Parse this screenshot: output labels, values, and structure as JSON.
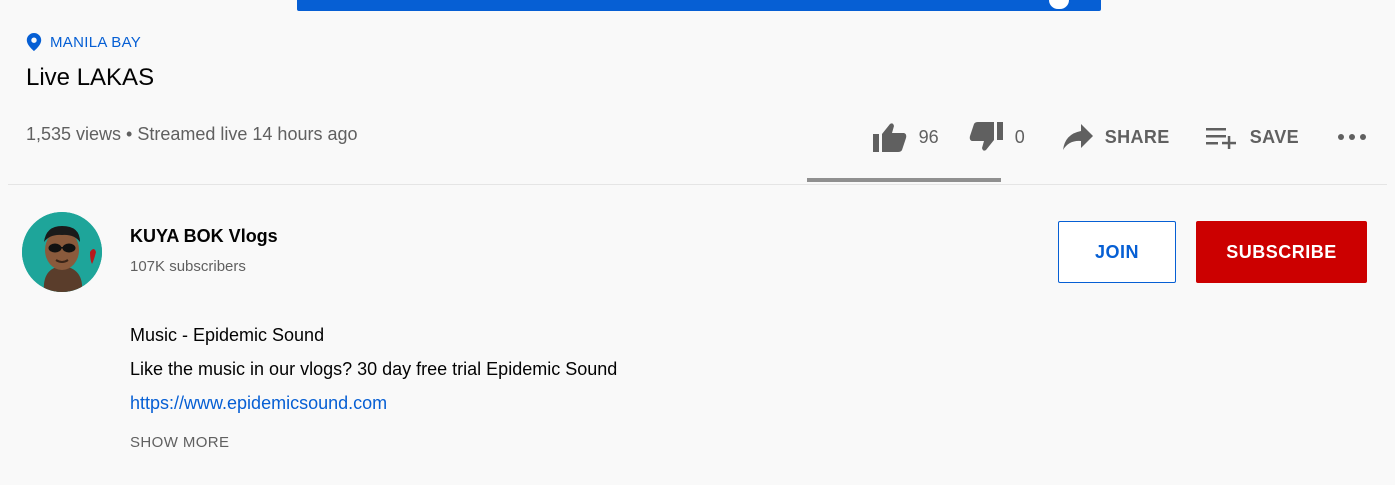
{
  "location": {
    "icon": "location-pin-icon",
    "text": "MANILA BAY"
  },
  "video": {
    "title": "Live LAKAS",
    "meta": "1,535 views • Streamed live 14 hours ago"
  },
  "actions": {
    "like": {
      "icon": "thumbs-up-icon",
      "count": "96"
    },
    "dislike": {
      "icon": "thumbs-down-icon",
      "count": "0"
    },
    "share": {
      "icon": "share-arrow-icon",
      "label": "SHARE"
    },
    "save": {
      "icon": "playlist-add-icon",
      "label": "SAVE"
    },
    "more": {
      "icon": "more-horizontal-icon",
      "label": "..."
    },
    "like_ratio": 1.0
  },
  "channel": {
    "name": "KUYA BOK Vlogs",
    "subscribers": "107K subscribers",
    "join_label": "JOIN",
    "subscribe_label": "SUBSCRIBE"
  },
  "description": {
    "lines": [
      "Music - Epidemic Sound",
      "Like the music in our vlogs? 30 day free trial Epidemic Sound"
    ],
    "link": "https://www.epidemicsound.com",
    "show_more": "SHOW MORE"
  },
  "colors": {
    "accent_blue": "#065fd4",
    "subscribe_red": "#cc0000",
    "secondary_text": "#606060",
    "avatar_bg": "#1ea59a"
  }
}
